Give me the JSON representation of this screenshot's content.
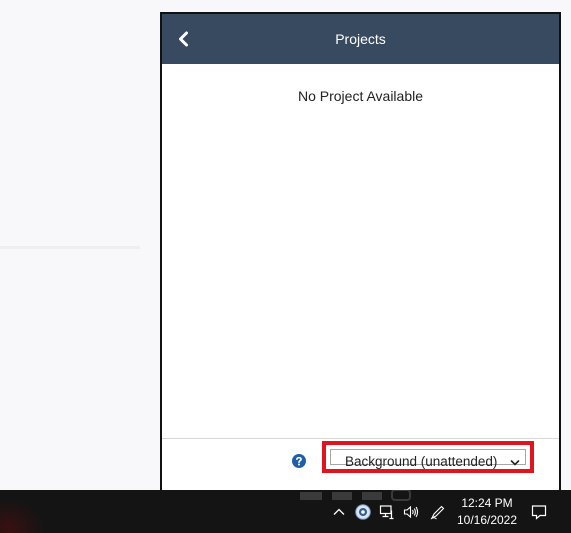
{
  "panel": {
    "title": "Projects",
    "back_icon": "chevron-left-icon",
    "empty_message": "No Project Available",
    "help_icon": "question-circle-icon",
    "mode_select": {
      "selected": "Background (unattended)"
    }
  },
  "taskbar": {
    "time": "12:24 PM",
    "date": "10/16/2022",
    "tray_icons": [
      "chevron-up-icon",
      "app-tray-icon",
      "network-icon",
      "volume-icon",
      "pen-icon",
      "notification-icon"
    ]
  },
  "colors": {
    "header_bg": "#384a5f",
    "highlight": "#e0141e",
    "help_blue": "#1f5fa8",
    "taskbar_bg": "#141414"
  }
}
